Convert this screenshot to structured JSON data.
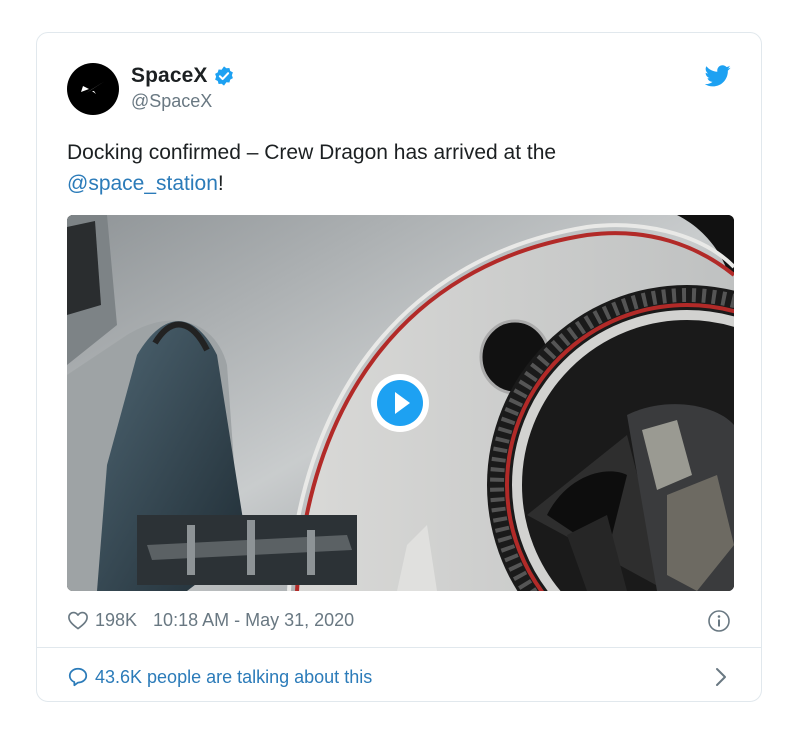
{
  "account": {
    "name": "SpaceX",
    "handle": "@SpaceX",
    "verified": true
  },
  "tweet": {
    "text_before": "Docking confirmed – Crew Dragon has arrived at the ",
    "mention": "@space_station",
    "text_after": "!"
  },
  "media": {
    "type": "video",
    "play_icon": "play-circle-icon"
  },
  "meta": {
    "likes": "198K",
    "timestamp": "10:18 AM - May 31, 2020"
  },
  "footer": {
    "conversation": "43.6K people are talking about this"
  },
  "colors": {
    "link": "#2b7bb9",
    "twitter_blue": "#1da1f2",
    "verified": "#1da1f2",
    "muted": "#697882",
    "border": "#e1e8ed"
  }
}
